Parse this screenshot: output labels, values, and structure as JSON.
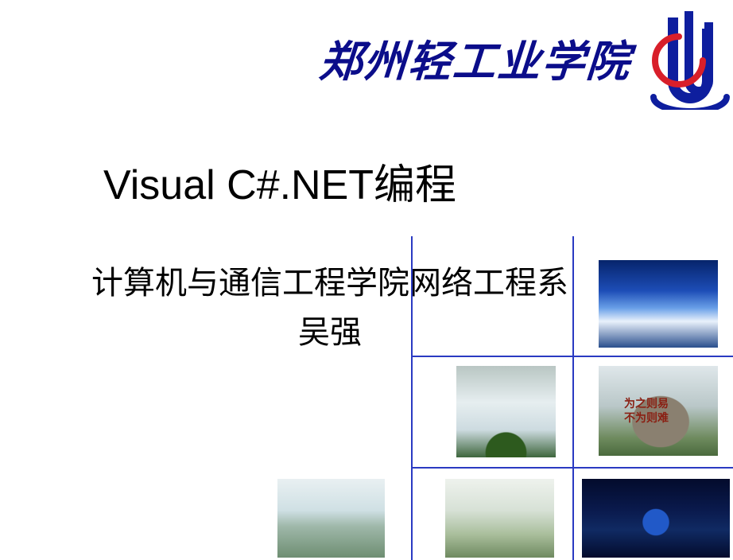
{
  "header": {
    "school_name": "郑州轻工业学院",
    "logo_name": "university-logo"
  },
  "main": {
    "title": "Visual C#.NET编程",
    "department": "计算机与通信工程学院网络工程系",
    "author": "吴强"
  },
  "accent_color": "#2a3ac2",
  "thumbnails": {
    "tile1": {
      "name": "campus-sky-photo",
      "stone_caption": ""
    },
    "tile2": {
      "name": "campus-trees-photo"
    },
    "tile3": {
      "name": "campus-stone-photo",
      "stone_caption": "为之则易\n不为则难"
    },
    "tile4": {
      "name": "campus-pavilion-photo"
    },
    "tile5": {
      "name": "campus-gazebo-photo"
    },
    "tile6": {
      "name": "campus-night-building-photo"
    }
  }
}
